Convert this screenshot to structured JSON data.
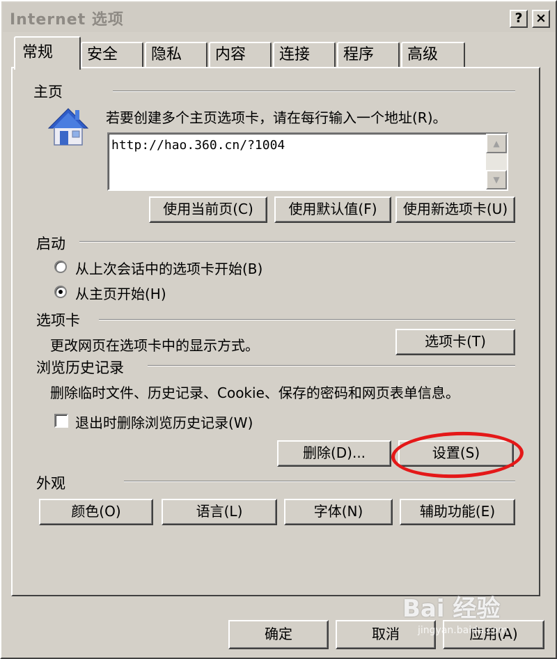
{
  "window": {
    "title": "Internet 选项",
    "help_label": "?",
    "close_label": "×"
  },
  "tabs": [
    {
      "label": "常规",
      "active": true
    },
    {
      "label": "安全"
    },
    {
      "label": "隐私"
    },
    {
      "label": "内容"
    },
    {
      "label": "连接"
    },
    {
      "label": "程序"
    },
    {
      "label": "高级"
    }
  ],
  "homepage": {
    "section_label": "主页",
    "instruction": "若要创建多个主页选项卡，请在每行输入一个地址(R)。",
    "url_value": "http://hao.360.cn/?1004",
    "buttons": {
      "use_current": "使用当前页(C)",
      "use_default": "使用默认值(F)",
      "use_new_tab": "使用新选项卡(U)"
    }
  },
  "startup": {
    "section_label": "启动",
    "options": [
      {
        "label": "从上次会话中的选项卡开始(B)",
        "selected": false
      },
      {
        "label": "从主页开始(H)",
        "selected": true
      }
    ]
  },
  "tabs_section": {
    "section_label": "选项卡",
    "description": "更改网页在选项卡中的显示方式。",
    "button": "选项卡(T)"
  },
  "history": {
    "section_label": "浏览历史记录",
    "description": "删除临时文件、历史记录、Cookie、保存的密码和网页表单信息。",
    "delete_on_exit_label": "退出时删除浏览历史记录(W)",
    "delete_on_exit_checked": false,
    "delete_button": "删除(D)...",
    "settings_button": "设置(S)"
  },
  "appearance": {
    "section_label": "外观",
    "buttons": {
      "colors": "颜色(O)",
      "languages": "语言(L)",
      "fonts": "字体(N)",
      "accessibility": "辅助功能(E)"
    }
  },
  "footer": {
    "ok": "确定",
    "cancel": "取消",
    "apply": "应用(A)"
  },
  "watermark": {
    "text": "Bai 经验",
    "subtext": "jingyan.baidu.com"
  },
  "colors": {
    "dialog_bg": "#d4d0c8",
    "highlight_ring": "#e41818"
  }
}
